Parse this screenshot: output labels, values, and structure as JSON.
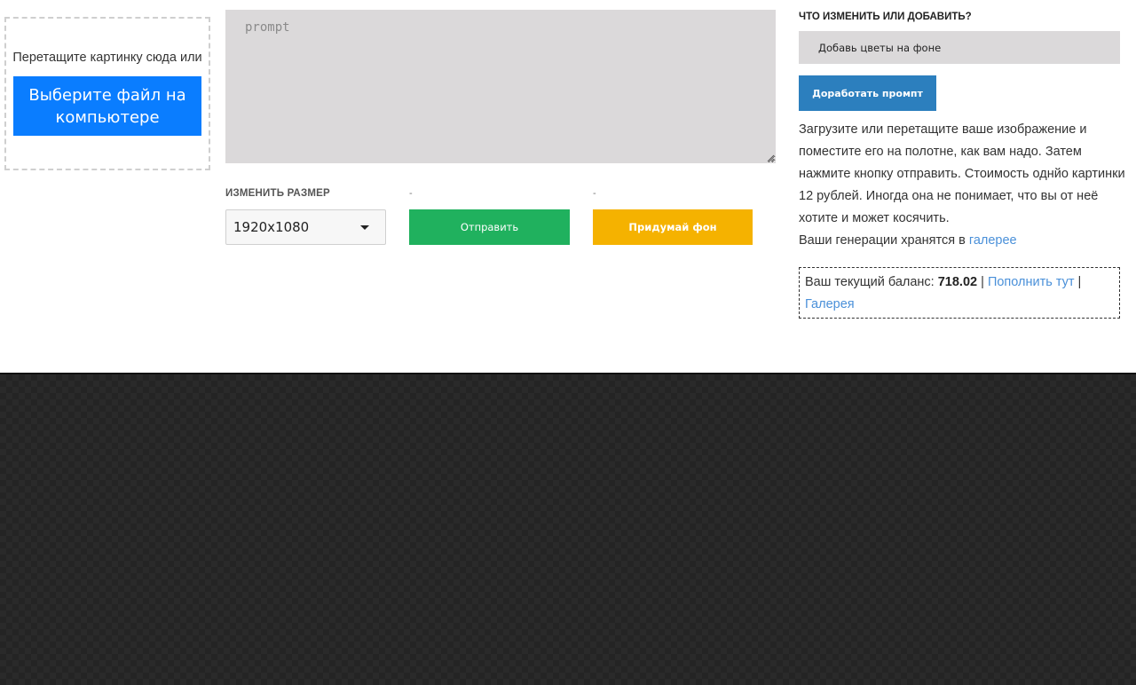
{
  "upload": {
    "drop_text": "Перетащите картинку сюда или",
    "file_button": "Выберите файл на компьютере"
  },
  "prompt": {
    "placeholder": "prompt"
  },
  "size": {
    "label": "ИЗМЕНИТЬ РАЗМЕР",
    "selected": "1920x1080"
  },
  "actions": {
    "dash_1": "-",
    "dash_2": "-",
    "send_label": "Отправить",
    "background_label": "Придумай фон"
  },
  "edit": {
    "label": "ЧТО ИЗМЕНИТЬ ИЛИ ДОБАВИТЬ?",
    "value": "Добавь цветы на фоне",
    "refine_button": "Доработать промпт"
  },
  "info": {
    "text": "Загрузите или перетащите ваше изображение и поместите его на полотне, как вам надо. Затем нажмите кнопку отправить. Стоимость однйо картинки 12 рублей. Иногда она не понимает, что вы от неё хотите и может косячить.",
    "gallery_prefix": "Ваши генерации хранятся в",
    "gallery_link": "галерее"
  },
  "balance": {
    "label": "Ваш текущий баланс:",
    "amount": "718.02",
    "separator": "|",
    "topup_link": "Пополнить тут",
    "gallery_link": "Галерея"
  },
  "colors": {
    "file_button": "#0a7dff",
    "send": "#20b15e",
    "background": "#f5b200",
    "refine": "#2c7fbe",
    "link": "#4a90d9"
  }
}
